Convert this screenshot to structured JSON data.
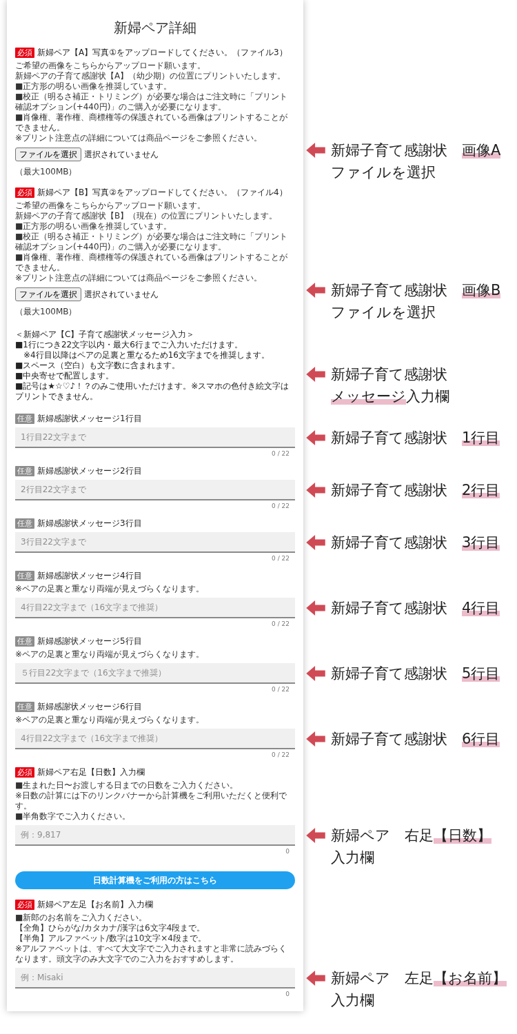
{
  "page": {
    "title": "新婦ペア詳細"
  },
  "sections": [
    {
      "kind": "file",
      "badge": {
        "text": "必須",
        "required": true
      },
      "label": "新婦ペア【A】写真①をアップロードしてください。（ファイル3）",
      "description": [
        "ご希望の画像をこちらからアップロード願います。",
        "新婦ペアの子育て感謝状【A】（幼少期）の位置にプリントいたします。",
        "■正方形の明るい画像を推奨しています。",
        "■校正（明るさ補正・トリミング）が必要な場合はご注文時に「プリント確認オプション(+440円)」のご購入が必要になります。",
        "■肖像権、著作権、商標権等の保護されている画像はプリントすることができません。",
        "※プリント注意点の詳細については商品ページをご参照ください。"
      ],
      "button": "ファイルを選択",
      "status": "選択されていません",
      "size_note": "（最大100MB）",
      "callout": [
        "新婦子育て感謝状　**画像A**",
        "ファイルを選択"
      ]
    },
    {
      "kind": "file",
      "badge": {
        "text": "必須",
        "required": true
      },
      "label": "新婦ペア【B】写真②をアップロードしてください。（ファイル4）",
      "description": [
        "ご希望の画像をこちらからアップロード願います。",
        "新婦ペアの子育て感謝状【B】（現在）の位置にプリントいたします。",
        "■正方形の明るい画像を推奨しています。",
        "■校正（明るさ補正・トリミング）が必要な場合はご注文時に「プリント確認オプション(+440円)」のご購入が必要になります。",
        "■肖像権、著作権、商標権等の保護されている画像はプリントすることができません。",
        "※プリント注意点の詳細については商品ページをご参照ください。"
      ],
      "button": "ファイルを選択",
      "status": "選択されていません",
      "size_note": "（最大100MB）",
      "callout": [
        "新婦子育て感謝状　**画像B**",
        "ファイルを選択"
      ]
    },
    {
      "kind": "notes",
      "lines": [
        "＜新婦ペア【C】子育て感謝状メッセージ入力＞",
        "■1行につき22文字以内・最大6行までご入力いただけます。",
        "　※4行目以降はペアの足裏と重なるため16文字までを推奨します。",
        "■スペース（空白）も文字数に含まれます。",
        "■中央寄せで配置します。",
        "■記号は★☆♡♪！？のみご使用いただけます。※スマホの色付き絵文字はプリントできません。"
      ],
      "callout": [
        "新婦子育て感謝状",
        "**メッセージ**入力欄"
      ]
    },
    {
      "kind": "text",
      "badge": {
        "text": "任意",
        "required": false
      },
      "label": "新婦感謝状メッセージ1行目",
      "placeholder": "1行目22文字まで",
      "counter": "0 / 22",
      "callout": [
        "新婦子育て感謝状　**1行目**"
      ]
    },
    {
      "kind": "text",
      "badge": {
        "text": "任意",
        "required": false
      },
      "label": "新婦感謝状メッセージ2行目",
      "placeholder": "2行目22文字まで",
      "counter": "0 / 22",
      "callout": [
        "新婦子育て感謝状　**2行目**"
      ]
    },
    {
      "kind": "text",
      "badge": {
        "text": "任意",
        "required": false
      },
      "label": "新婦感謝状メッセージ3行目",
      "placeholder": "3行目22文字まで",
      "counter": "0 / 22",
      "callout": [
        "新婦子育て感謝状　**3行目**"
      ]
    },
    {
      "kind": "text",
      "badge": {
        "text": "任意",
        "required": false
      },
      "label": "新婦感謝状メッセージ4行目",
      "description": [
        "※ペアの足裏と重なり両端が見えづらくなります。"
      ],
      "placeholder": "4行目22文字まで（16文字まで推奨）",
      "counter": "0 / 22",
      "callout": [
        "新婦子育て感謝状　**4行目**"
      ]
    },
    {
      "kind": "text",
      "badge": {
        "text": "任意",
        "required": false
      },
      "label": "新婦感謝状メッセージ5行目",
      "description": [
        "※ペアの足裏と重なり両端が見えづらくなります。"
      ],
      "placeholder": "５行目22文字まで（16文字まで推奨）",
      "counter": "0 / 22",
      "callout": [
        "新婦子育て感謝状　**5行目**"
      ]
    },
    {
      "kind": "text",
      "badge": {
        "text": "任意",
        "required": false
      },
      "label": "新婦感謝状メッセージ6行目",
      "description": [
        "※ペアの足裏と重なり両端が見えづらくなります。"
      ],
      "placeholder": "4行目22文字まで（16文字まで推奨）",
      "counter": "0 / 22",
      "callout": [
        "新婦子育て感謝状　**6行目**"
      ]
    },
    {
      "kind": "text",
      "badge": {
        "text": "必須",
        "required": true
      },
      "label": "新婦ペア右足【日数】入力欄",
      "description": [
        "■生まれた日〜お渡しする日までの日数をご入力ください。",
        "※日数の計算には下のリンクバナーから計算機をご利用いただくと便利です。",
        "■半角数字でご入力ください。"
      ],
      "placeholder": "例：9,817",
      "counter": "0",
      "callout": [
        "新婦ペア　右足**【日数】**",
        "入力欄"
      ]
    },
    {
      "kind": "link_button",
      "text": "日数計算機をご利用の方はこちら"
    },
    {
      "kind": "text",
      "badge": {
        "text": "必須",
        "required": true
      },
      "label": "新婦ペア左足【お名前】入力欄",
      "description": [
        "■新郎のお名前をご入力ください。",
        "【全角】ひらがな/カタカナ/漢字は6文字4段まで。",
        "【半角】アルファベット/数字は10文字×4段まで。",
        "※アルファベットは、すべて大文字でご入力されますと非常に読みづらくなります。頭文字のみ大文字でのご入力をおすすめします。"
      ],
      "placeholder": "例：Misaki",
      "counter": "0",
      "callout": [
        "新婦ペア　左足**【お名前】**",
        "入力欄"
      ]
    }
  ]
}
